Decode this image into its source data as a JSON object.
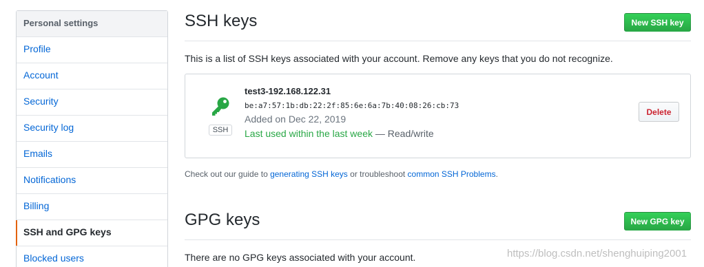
{
  "sidebar": {
    "header": "Personal settings",
    "items": [
      {
        "label": "Profile"
      },
      {
        "label": "Account"
      },
      {
        "label": "Security"
      },
      {
        "label": "Security log"
      },
      {
        "label": "Emails"
      },
      {
        "label": "Notifications"
      },
      {
        "label": "Billing"
      },
      {
        "label": "SSH and GPG keys",
        "selected": true
      },
      {
        "label": "Blocked users"
      }
    ]
  },
  "ssh": {
    "title": "SSH keys",
    "new_button": "New SSH key",
    "description": "This is a list of SSH keys associated with your account. Remove any keys that you do not recognize.",
    "key": {
      "title": "test3-192.168.122.31",
      "fingerprint": "be:a7:57:1b:db:22:2f:85:6e:6a:7b:40:08:26:cb:73",
      "added": "Added on Dec 22, 2019",
      "last_used": "Last used within the last week",
      "access": " — Read/write",
      "type_label": "SSH",
      "delete_button": "Delete",
      "icon": "key-icon",
      "icon_color": "#28a745"
    },
    "guide": {
      "prefix": "Check out our guide to ",
      "link1": "generating SSH keys",
      "middle": " or troubleshoot ",
      "link2": "common SSH Problems",
      "suffix": "."
    }
  },
  "gpg": {
    "title": "GPG keys",
    "new_button": "New GPG key",
    "description": "There are no GPG keys associated with your account."
  },
  "watermark": "https://blog.csdn.net/shenghuiping2001",
  "colors": {
    "accent": "#0366d6",
    "primary_button": "#28a745",
    "danger": "#cb2431",
    "selected_indicator": "#e36209"
  }
}
